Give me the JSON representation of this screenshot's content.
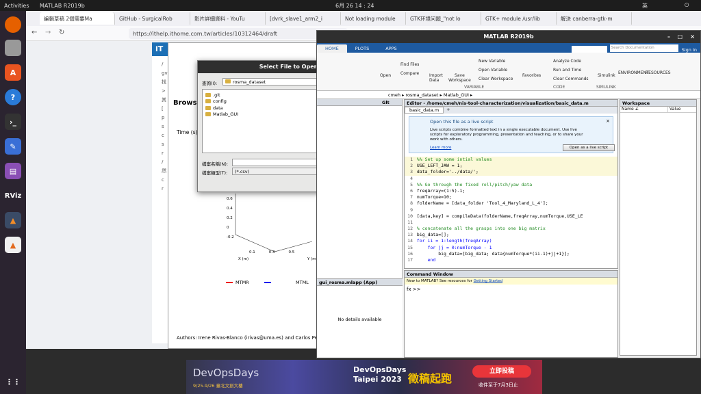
{
  "topbar": {
    "activities": "Activities",
    "app": "MATLAB R2019b",
    "clock": "6月 26 14 : 24",
    "lang": "英"
  },
  "tabs": [
    {
      "label": "編輯草稿 2個需要Ma"
    },
    {
      "label": "GitHub - SurgicalRob"
    },
    {
      "label": "影片詳細資料 - YouTu"
    },
    {
      "label": "[dvrk_slave1_arm2_i"
    },
    {
      "label": "Not loading module"
    },
    {
      "label": "GTK环境问题_\"not lo"
    },
    {
      "label": "GTK+ module /usr/lib"
    },
    {
      "label": "解決 canberra-gtk-m"
    }
  ],
  "url": "https://ithelp.ithome.com.tw/articles/10312464/draft",
  "bgpage": {
    "logo": "iT",
    "heading": "Browse",
    "time_label": "Time (s)",
    "axis_vals": [
      "0.6",
      "0.4",
      "0.2",
      "0",
      "-0.2"
    ],
    "x_label": "X (m)",
    "x_ticks": [
      "0.1",
      "0.3",
      "0.5"
    ],
    "y_label": "Y (m)",
    "legend": [
      "MTMR",
      "MTML"
    ],
    "authors": "Authors: Irene Rivas-Blanco (irivas@uma.es) and Carlos Pére",
    "left_snips": [
      "/",
      "gv",
      "找",
      ">",
      "其",
      "[",
      "p",
      "s",
      "c",
      "s",
      "r",
      "/",
      "然",
      "c",
      "r"
    ]
  },
  "dialog": {
    "title": "Select File to Open",
    "lookin_label": "查詢(I):",
    "lookin_value": "rosma_dataset",
    "files": [
      ".git",
      "config",
      "data",
      "Matlab_GUI"
    ],
    "filename_label": "檔案名稱(N):",
    "filename_value": "",
    "filetype_label": "檔案類型(T):",
    "filetype_value": "(*.csv)",
    "open_btn": "開啟",
    "cancel_btn": "取消"
  },
  "matlab": {
    "title": "MATLAB R2019b",
    "tabs": [
      "HOME",
      "PLOTS",
      "APPS"
    ],
    "search_placeholder": "Search Documentation",
    "signin": "Sign In",
    "ribbon": {
      "open": "Open",
      "find_files": "Find Files",
      "compare": "Compare",
      "import": "Import\nData",
      "save_ws": "Save\nWorkspace",
      "new_var": "New Variable",
      "open_var": "Open Variable",
      "clear_ws": "Clear Workspace",
      "variable_group": "VARIABLE",
      "favorites": "Favorites",
      "analyze": "Analyze Code",
      "run_time": "Run and Time",
      "clear_cmds": "Clear Commands",
      "code_group": "CODE",
      "simulink": "Simulink",
      "simulink_group": "SIMULINK",
      "environment": "ENVIRONMENT",
      "resources": "RESOURCES"
    },
    "path": "cmeh  ▸ rosma_dataset ▸ Matlab_GUI ▸",
    "file_col": "Glt",
    "editor_title": "Editor - /home/cmeh/nis-tool-characterization/visualization/basic_data.m",
    "editor_tab": "basic_data.m",
    "live_title": "Open this file as a live script",
    "live_body": "Live scripts combine formatted text in a single executable document. Use live scripts for exploratory programming, presentation and teaching, or to share your work with others.",
    "live_link": "Learn more",
    "live_btn": "Open as a live script",
    "code": [
      {
        "n": "1",
        "t": "%% Set up some intial values",
        "c": "cmt"
      },
      {
        "n": "2",
        "t": "USE_LEFT_JAW = 1;",
        "c": ""
      },
      {
        "n": "3",
        "t": "data_folder='../data/';",
        "c": ""
      },
      {
        "n": "4",
        "t": "",
        "c": ""
      },
      {
        "n": "5",
        "t": "%% Go through the fixed roll/pitch/yaw data",
        "c": "cmt"
      },
      {
        "n": "6",
        "t": "freqArray=(1:5)-1;",
        "c": ""
      },
      {
        "n": "7",
        "t": "numTorque=10;",
        "c": ""
      },
      {
        "n": "8",
        "t": "folderName = [data_folder 'Tool_4_Maryland_L_4'];",
        "c": ""
      },
      {
        "n": "9",
        "t": "",
        "c": ""
      },
      {
        "n": "10",
        "t": "[data,key] = compileData(folderName,freqArray,numTorque,USE_LE",
        "c": ""
      },
      {
        "n": "11",
        "t": "",
        "c": ""
      },
      {
        "n": "12",
        "t": "% concatenate all the grasps into one big matrix",
        "c": "cmt"
      },
      {
        "n": "13",
        "t": "big_data=[];",
        "c": ""
      },
      {
        "n": "14",
        "t": "for ii = 1:length(freqArray)",
        "c": "kw"
      },
      {
        "n": "15",
        "t": "    for jj = 0:numTorque - 1",
        "c": "kw"
      },
      {
        "n": "16",
        "t": "        big_data=[big_data; data{numTorque*(ii-1)+jj+1}];",
        "c": ""
      },
      {
        "n": "17",
        "t": "    end",
        "c": "kw"
      }
    ],
    "app_panel": "gui_rosma.mlapp  (App)",
    "no_details": "No details available",
    "cmd_title": "Command Window",
    "cmd_notice": "New to MATLAB? See resources for",
    "cmd_link": "Getting Started",
    "prompt": "fx >>",
    "ws_title": "Workspace",
    "ws_name": "Name ∠",
    "ws_value": "Value"
  },
  "banner": {
    "title": "DevOpsDays",
    "dates": "9/25-9/26 臺北文創大樓",
    "city": "DevOpsDays\nTaipei 2023",
    "cta": "徵稿起跑",
    "submit": "立即投稿",
    "deadline": "收件至于7月3日止"
  }
}
